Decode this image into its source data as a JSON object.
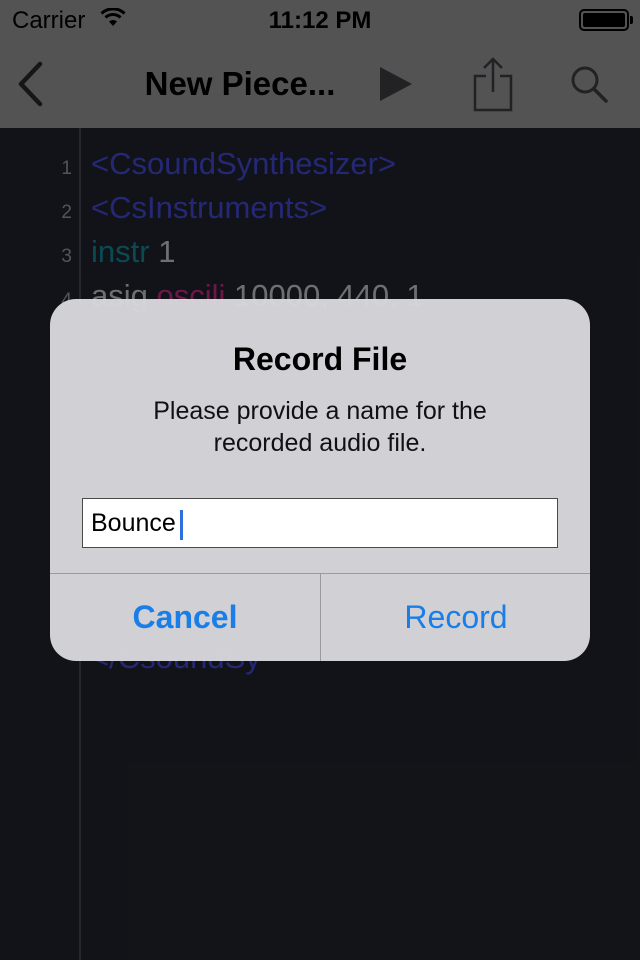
{
  "status_bar": {
    "carrier": "Carrier",
    "time": "11:12 PM"
  },
  "nav": {
    "title": "New Piece...",
    "icons": [
      "chevron-left-icon",
      "play-icon",
      "share-icon",
      "search-icon"
    ]
  },
  "editor": {
    "lines": [
      {
        "number": "1",
        "text": "<CsoundSynthesizer>"
      },
      {
        "number": "2",
        "text": "<CsInstruments>"
      },
      {
        "number": "3",
        "keyword": "instr",
        "rest": " 1"
      },
      {
        "number": "4",
        "plain1": "asig ",
        "opcode": "oscili",
        "plain2": " 10000, 440, 1"
      }
    ],
    "hidden_partial_text": "</CsoundSy"
  },
  "alert": {
    "title": "Record File",
    "message": "Please provide a name for the recorded audio file.",
    "input_value": "Bounce",
    "cancel_label": "Cancel",
    "record_label": "Record"
  },
  "colors": {
    "accent": "#1a7ee8",
    "tag": "#3c44c4",
    "keyword": "#127c8a",
    "opcode": "#b5257a",
    "editor_bg": "#1f2128"
  }
}
